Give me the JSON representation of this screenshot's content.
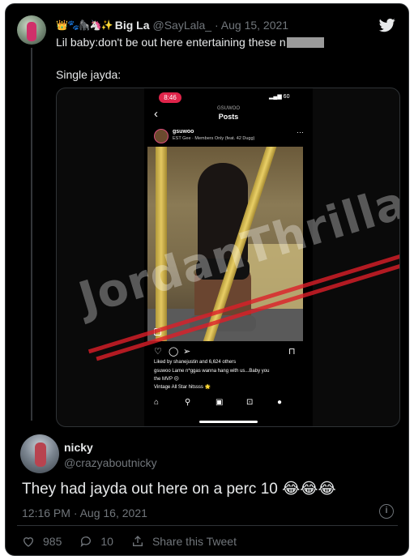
{
  "quoted": {
    "emoji": "👑🐾🦍🦄✨",
    "name": "Big La",
    "handle": "@SayLala_",
    "date": "Aug 15, 2021",
    "text_line1": "Lil baby:don't be out here entertaining these n",
    "text_line2": "Single jayda:"
  },
  "phone": {
    "status_time": "8:46",
    "status_right": "60",
    "header_handle": "GSUWOO",
    "header_title": "Posts",
    "post_user": "gsuwoo",
    "post_song": "EST Gee · Members Only (feat. 42 Dugg)",
    "liked_by": "Liked by shanejustin and 6,624 others",
    "caption_line1": "gsuwoo Lame n*ggas wanna hang with us...Baby you",
    "caption_line2": "the MVP 😔",
    "caption_line3": "Vintage All Star hitssss 🌟"
  },
  "watermark": "JordanThrilla.",
  "tweet": {
    "name": "nicky",
    "handle": "@crazyaboutnicky",
    "text": "They had jayda out here on a perc 10 😂😂😂",
    "timestamp": "12:16 PM · Aug 16, 2021",
    "likes": "985",
    "replies": "10",
    "share_label": "Share this Tweet"
  },
  "colors": {
    "background": "#000000",
    "text": "#e7e9ea",
    "muted": "#71767b",
    "border": "#2f3336"
  }
}
